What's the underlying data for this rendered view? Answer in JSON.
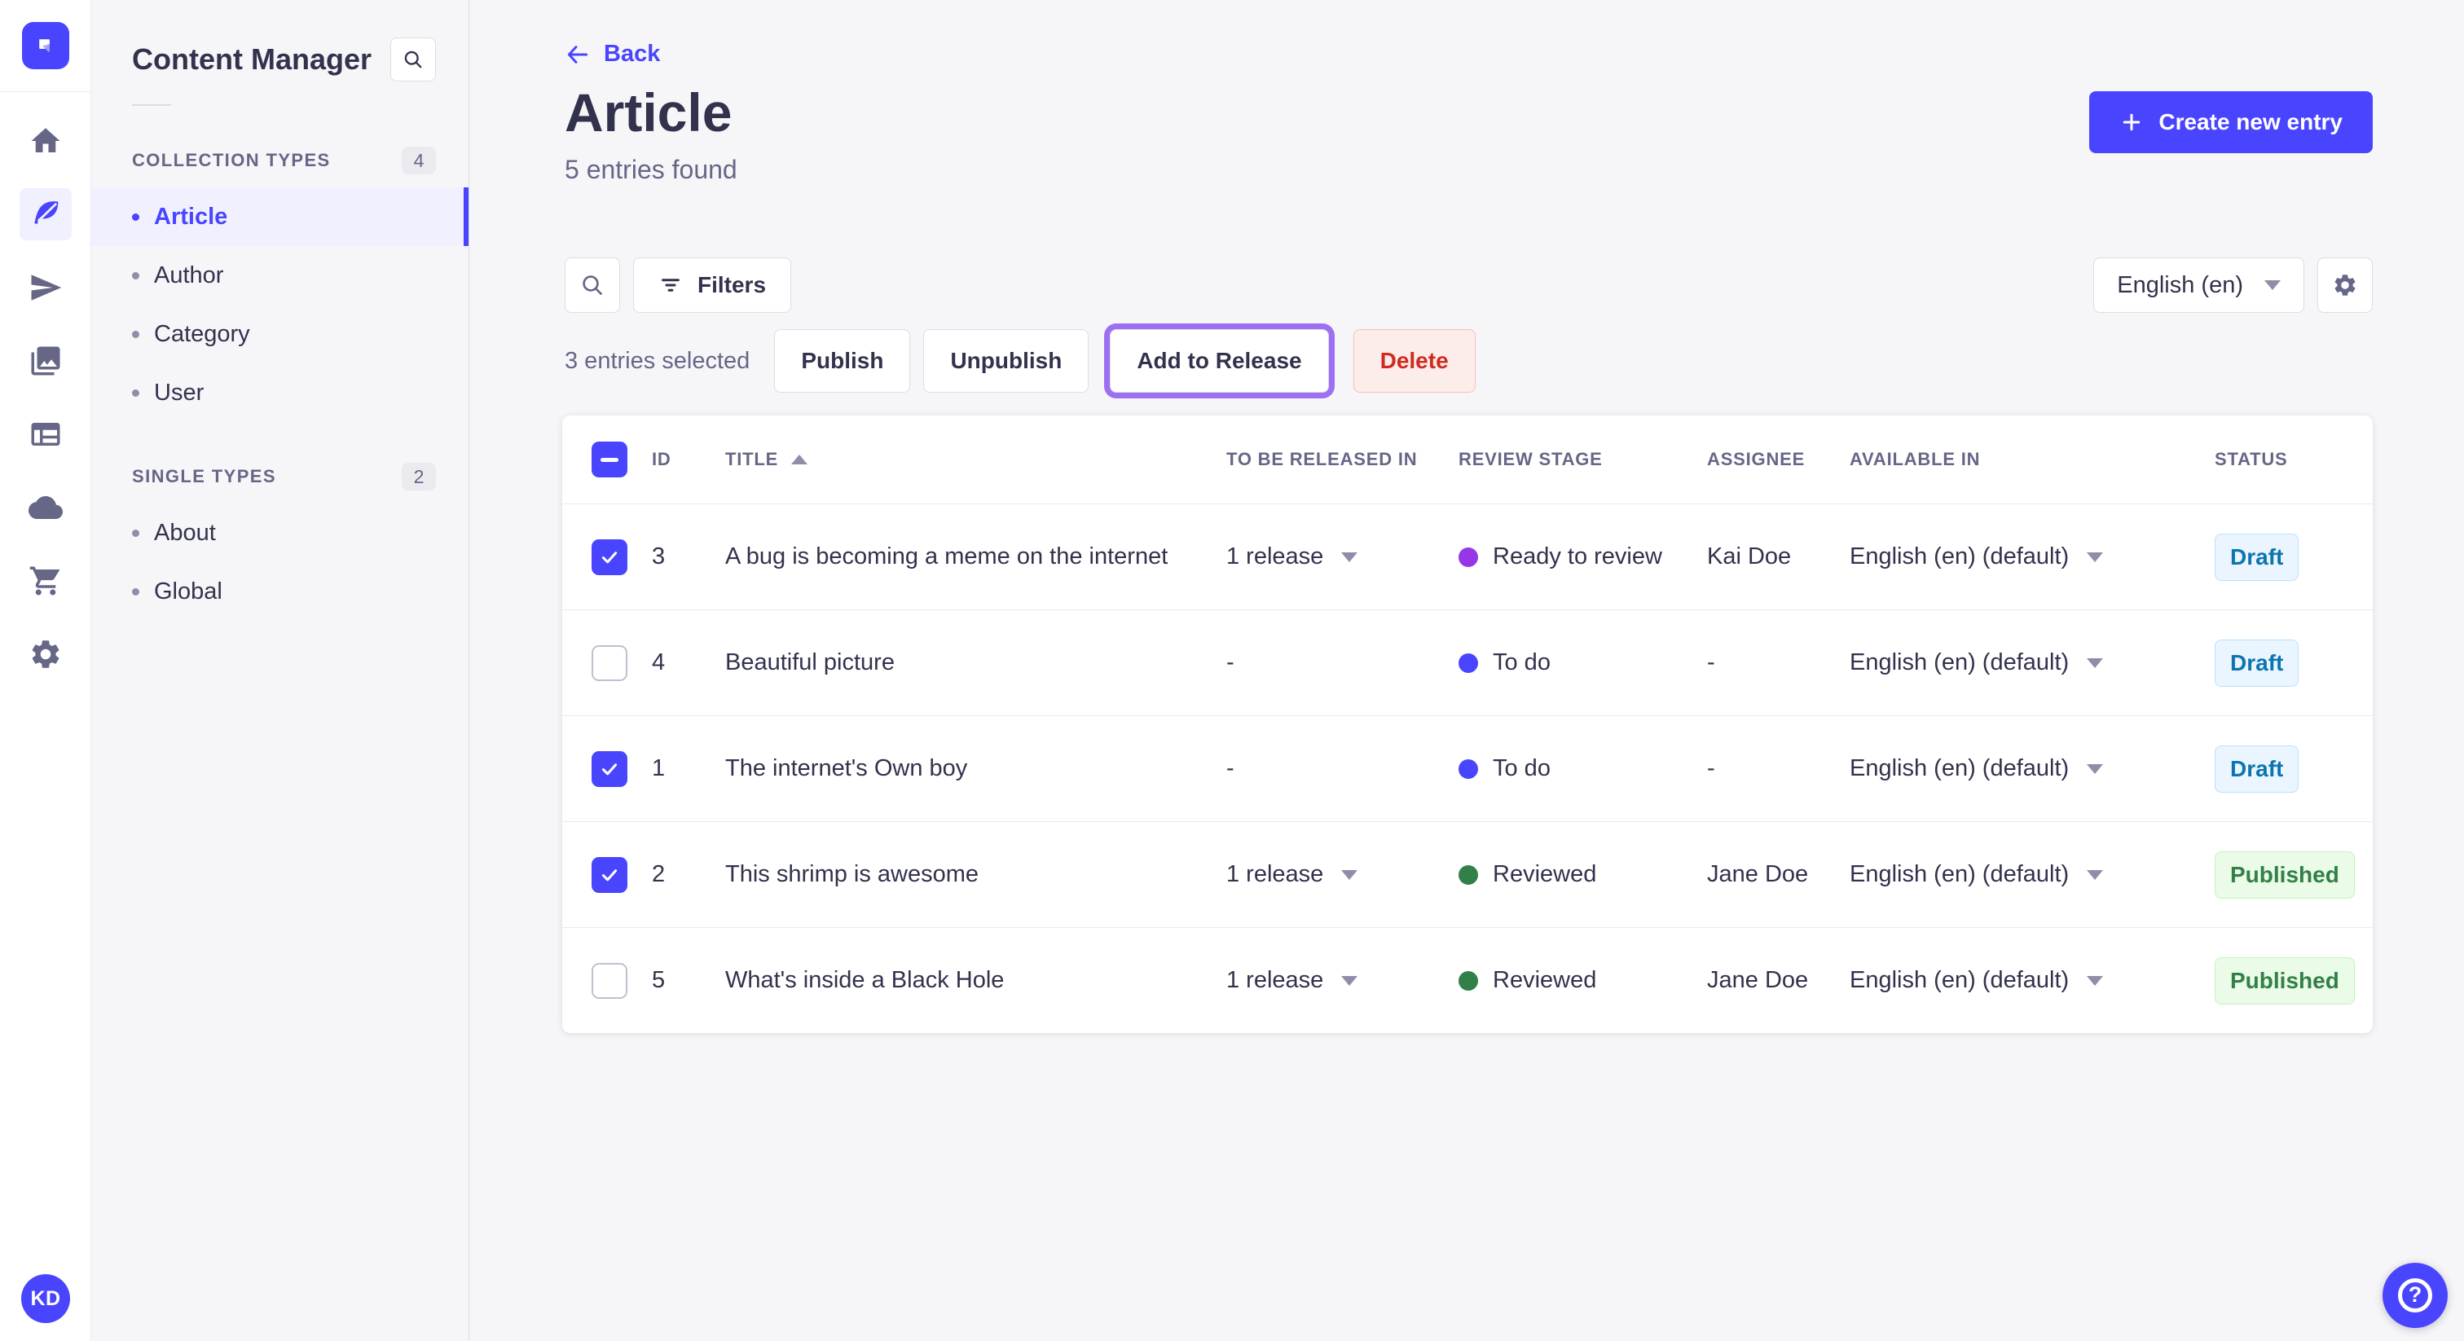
{
  "rail": {
    "logo_icon": "strapi-logo-icon",
    "icons": [
      "home-icon",
      "content-manager-icon",
      "plane-icon",
      "media-library-icon",
      "layout-icon",
      "cloud-icon",
      "marketplace-cart-icon",
      "settings-gear-icon"
    ],
    "avatar": "KD"
  },
  "sidebar": {
    "title": "Content Manager",
    "search_icon": "search-icon",
    "sections": [
      {
        "label": "COLLECTION TYPES",
        "count": "4",
        "items": [
          {
            "label": "Article",
            "active": true
          },
          {
            "label": "Author"
          },
          {
            "label": "Category"
          },
          {
            "label": "User"
          }
        ]
      },
      {
        "label": "SINGLE TYPES",
        "count": "2",
        "items": [
          {
            "label": "About"
          },
          {
            "label": "Global"
          }
        ]
      }
    ]
  },
  "header": {
    "back_label": "Back",
    "title": "Article",
    "subtitle": "5 entries found",
    "create_button_label": "Create new entry"
  },
  "toolbar": {
    "filters_label": "Filters",
    "locale_value": "English (en)"
  },
  "selection": {
    "label": "3 entries selected",
    "publish_label": "Publish",
    "unpublish_label": "Unpublish",
    "add_to_release_label": "Add to Release",
    "delete_label": "Delete"
  },
  "table": {
    "headers": {
      "id": "ID",
      "title": "TITLE",
      "released": "TO BE RELEASED IN",
      "review": "REVIEW STAGE",
      "assignee": "ASSIGNEE",
      "available": "AVAILABLE IN",
      "status": "STATUS"
    },
    "rows": [
      {
        "checked": true,
        "id": "3",
        "title": "A bug is becoming a meme on the internet",
        "released": "1 release",
        "stage": "Ready to review",
        "stage_color": "#9736e8",
        "assignee": "Kai Doe",
        "available": "English (en) (default)",
        "status": "Draft"
      },
      {
        "checked": false,
        "id": "4",
        "title": "Beautiful picture",
        "released": "-",
        "stage": "To do",
        "stage_color": "#4945ff",
        "assignee": "-",
        "available": "English (en) (default)",
        "status": "Draft"
      },
      {
        "checked": true,
        "id": "1",
        "title": "The internet's Own boy",
        "released": "-",
        "stage": "To do",
        "stage_color": "#4945ff",
        "assignee": "-",
        "available": "English (en) (default)",
        "status": "Draft"
      },
      {
        "checked": true,
        "id": "2",
        "title": "This shrimp is awesome",
        "released": "1 release",
        "stage": "Reviewed",
        "stage_color": "#328048",
        "assignee": "Jane Doe",
        "available": "English (en) (default)",
        "status": "Published"
      },
      {
        "checked": false,
        "id": "5",
        "title": "What's inside a Black Hole",
        "released": "1 release",
        "stage": "Reviewed",
        "stage_color": "#328048",
        "assignee": "Jane Doe",
        "available": "English (en) (default)",
        "status": "Published"
      }
    ]
  },
  "help": {
    "glyph": "?"
  },
  "colors": {
    "primary": "#4945ff",
    "danger": "#d02b20",
    "draft_text": "#0c75af",
    "published_text": "#328048",
    "release_focus_ring": "#9d6ff3"
  }
}
